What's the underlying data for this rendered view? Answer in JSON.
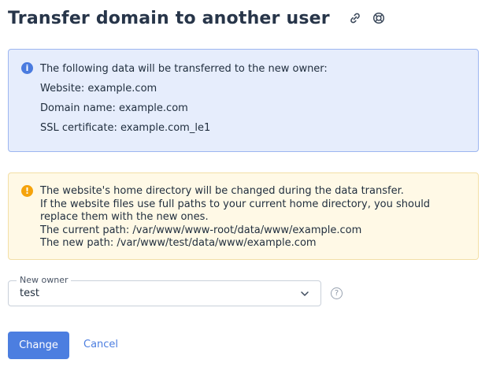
{
  "header": {
    "title": "Transfer domain to another user",
    "icons": [
      "link-icon",
      "help-lifebuoy-icon"
    ]
  },
  "info_box": {
    "icon": "info-icon",
    "icon_glyph": "i",
    "lines": [
      "The following data will be transferred to the new owner:",
      "Website: example.com",
      "Domain name: example.com",
      "SSL certificate: example.com_le1"
    ],
    "colors": {
      "background": "#e6edfc",
      "border": "#9db6f0",
      "icon": "#4a7bdf"
    }
  },
  "warning_box": {
    "icon": "warning-icon",
    "icon_glyph": "!",
    "lines": [
      "The website's home directory will be changed during the data transfer.",
      "If the website files use full paths to your current home directory, you should replace them with the new ones.",
      "The current path: /var/www/www-root/data/www/example.com",
      "The new path: /var/www/test/data/www/example.com"
    ],
    "colors": {
      "background": "#fff9e6",
      "border": "#f3dfa6",
      "icon": "#f5a30c"
    }
  },
  "owner_field": {
    "label": "New owner",
    "value": "test",
    "help_glyph": "?"
  },
  "actions": {
    "submit_label": "Change",
    "cancel_label": "Cancel"
  },
  "colors": {
    "accent": "#4c7ee0",
    "title": "#273549"
  }
}
